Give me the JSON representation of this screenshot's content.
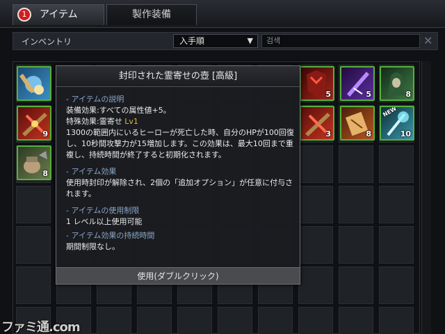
{
  "tabs": {
    "items_badge": "1",
    "items_label": "アイテム",
    "crafting_label": "製作装備"
  },
  "filter": {
    "inventory_label": "インベントリ",
    "sort_value": "入手順",
    "search_placeholder": "검색"
  },
  "inventory": {
    "items": [
      {
        "icon": "blue-orb-cannon-icon",
        "count": ""
      },
      {
        "icon": "red-crossbow-icon",
        "count": "9"
      },
      {
        "icon": "sealed-pot-icon",
        "count": "8"
      },
      {
        "icon": "red-dragon-armor-icon",
        "count": "5"
      },
      {
        "icon": "purple-blade-icon",
        "count": "5"
      },
      {
        "icon": "green-hood-icon",
        "count": "8"
      },
      {
        "icon": "red-crossbow-icon",
        "count": "3"
      },
      {
        "icon": "orange-scroll-icon",
        "count": "8"
      },
      {
        "icon": "new-crystal-staff-icon",
        "count": "10",
        "badge": "NEW"
      }
    ]
  },
  "tooltip": {
    "title": "封印された霊寄せの壺 [高級]",
    "section_desc": "- アイテムの説明",
    "equip_effect": "装備効果:すべての属性値+5。",
    "special_effect_prefix": "特殊効果:霊寄せ",
    "special_effect_level": "Lv1",
    "desc_text": "1300の範囲内にいるヒーローが死亡した時、自分のHPが100回復し、10秒間攻撃力が15増加します。この効果は、最大10回まで重複し、持続時間が終了すると初期化されます。",
    "section_effect": "- アイテム効果",
    "effect_text": "使用時封印が解除され、2個の「追加オプション」が任意に付与されます。",
    "section_limit": "- アイテムの使用制限",
    "limit_text": "1 レベル以上使用可能",
    "section_duration": "- アイテム効果の持続時間",
    "duration_text": "期間制限なし。",
    "use_label": "使用(ダブルクリック)"
  },
  "watermark": "ファミ通.com",
  "colors": {
    "item_border": "#56b23a",
    "section_header": "#8ba6c8",
    "level_text": "#e2b43b",
    "badge": "#d01e1e"
  }
}
